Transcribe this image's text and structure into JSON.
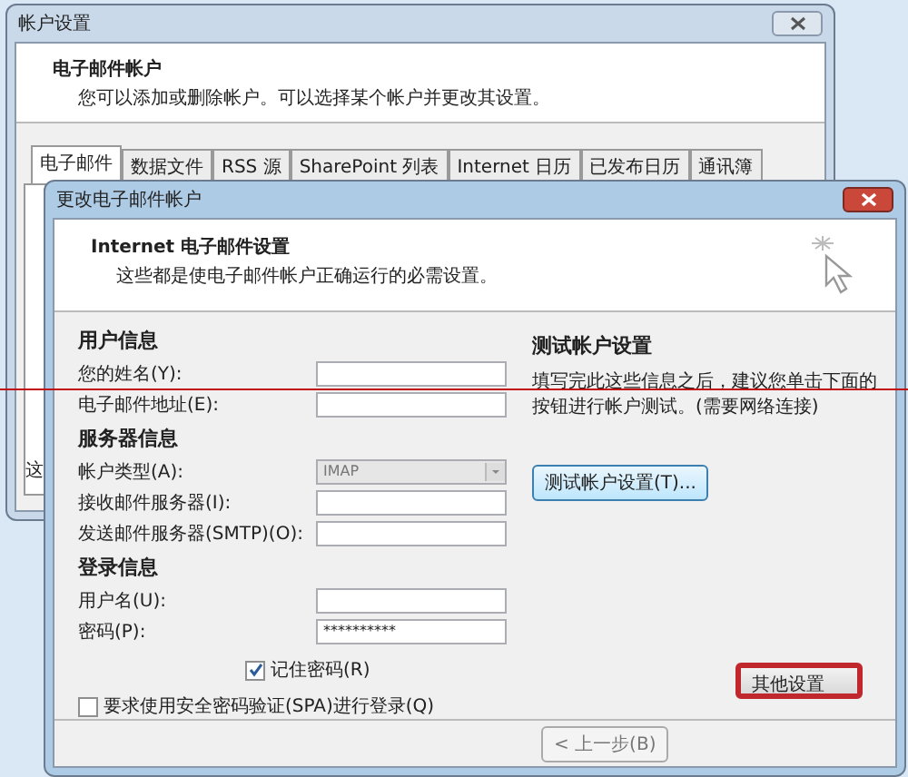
{
  "outer_window": {
    "title": "帐户设置",
    "header_title": "电子邮件帐户",
    "header_subtitle": "您可以添加或删除帐户。可以选择某个帐户并更改其设置。",
    "tabs": [
      {
        "label": "电子邮件",
        "selected": true
      },
      {
        "label": "数据文件",
        "selected": false
      },
      {
        "label": "RSS 源",
        "selected": false
      },
      {
        "label": "SharePoint 列表",
        "selected": false
      },
      {
        "label": "Internet 日历",
        "selected": false
      },
      {
        "label": "已发布日历",
        "selected": false
      },
      {
        "label": "通讯簿",
        "selected": false
      }
    ],
    "panel_text": "这"
  },
  "dialog": {
    "title": "更改电子邮件帐户",
    "header_title": "Internet 电子邮件设置",
    "header_subtitle": "这些都是使电子邮件帐户正确运行的必需设置。",
    "sections": [
      {
        "heading": "用户信息",
        "fields": [
          {
            "label": "您的姓名(Y):",
            "kind": "text",
            "disabled": false
          },
          {
            "label": "电子邮件地址(E):",
            "kind": "text",
            "disabled": false
          }
        ]
      },
      {
        "heading": "服务器信息",
        "fields": [
          {
            "label": "帐户类型(A):",
            "kind": "select",
            "value": "IMAP",
            "disabled": true
          },
          {
            "label": "接收邮件服务器(I):",
            "kind": "text",
            "disabled": false
          },
          {
            "label": "发送邮件服务器(SMTP)(O):",
            "kind": "text",
            "disabled": false
          }
        ]
      },
      {
        "heading": "登录信息",
        "fields": [
          {
            "label": "用户名(U):",
            "kind": "text",
            "disabled": false
          },
          {
            "label": "密码(P):",
            "kind": "password",
            "value": "**********",
            "disabled": false
          }
        ]
      }
    ],
    "options": [
      {
        "label": "记住密码(R)",
        "checked": true,
        "kind": "indented"
      },
      {
        "label": "要求使用安全密码验证(SPA)进行登录(Q)",
        "checked": false,
        "kind": "plain"
      }
    ],
    "test": {
      "heading": "测试帐户设置",
      "text": "填写完此这些信息之后，建议您单击下面的按钮进行帐户测试。(需要网络连接)",
      "button": "测试帐户设置(T)..."
    },
    "more_button": {
      "label": "其他设置",
      "highlighted": true
    },
    "back_button": {
      "label": "< 上一步(B)"
    }
  },
  "annotation_line": true
}
